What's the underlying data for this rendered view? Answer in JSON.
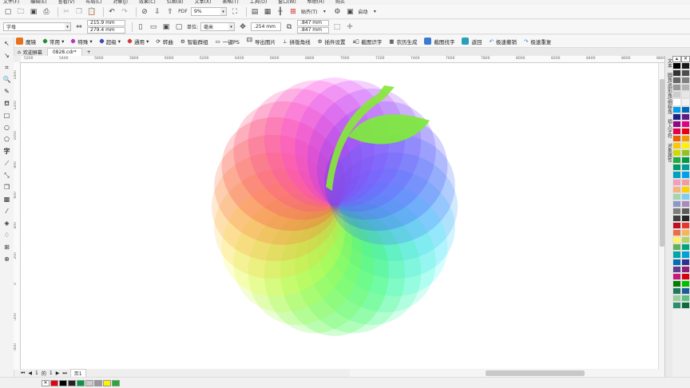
{
  "menubar": {
    "items": [
      "文件(F)",
      "编辑(E)",
      "查看(V)",
      "布局(L)",
      "对象(J)",
      "效果(C)",
      "位图(B)",
      "文本(X)",
      "表格(T)",
      "工具(O)",
      "窗口(W)",
      "帮助(H)",
      "购买"
    ]
  },
  "toolbar1": {
    "zoom_value": "9%",
    "snap_label": "贴齐(T)",
    "launch_label": "启动"
  },
  "toolbar2": {
    "preset_value": "字母",
    "width_value": "215.9 mm",
    "height_value": "279.4 mm",
    "units_label": "单位:",
    "units_value": "毫米",
    "nudge_value": ".254 mm",
    "dup_x_value": ".847 mm",
    "dup_y_value": ".847 mm"
  },
  "plugins": [
    {
      "label": "魔镜",
      "color": "#e8701a"
    },
    {
      "label": "常用",
      "color": "#2a8c3a"
    },
    {
      "label": "特殊",
      "color": "#b83ab8"
    },
    {
      "label": "超级",
      "color": "#3a4ab8"
    },
    {
      "label": "通用",
      "color": "#d43a3a"
    },
    {
      "label": "转曲",
      "color": "#555555"
    },
    {
      "label": "智能群组",
      "color": "#555555"
    },
    {
      "label": "一键PS",
      "color": "#555555"
    },
    {
      "label": "导出图片",
      "color": "#555555"
    },
    {
      "label": "拼版角线",
      "color": "#555555"
    },
    {
      "label": "插件设置",
      "color": "#555555"
    },
    {
      "label": "截图识字",
      "color": "#555555"
    },
    {
      "label": "农历生成",
      "color": "#555555"
    },
    {
      "label": "截图找字",
      "color": "#3a7ad4"
    },
    {
      "label": "返回",
      "color": "#2aa0b8"
    },
    {
      "label": "极速撤销",
      "color": "#3a7ad4"
    },
    {
      "label": "极速重复",
      "color": "#3a7ad4"
    }
  ],
  "tabs": [
    {
      "label": "欢迎屏幕"
    },
    {
      "label": "0828.cdr*"
    }
  ],
  "ruler_top_ticks": [
    "5200",
    "5400",
    "5600",
    "5800",
    "6000",
    "6200",
    "6400",
    "6600",
    "6800",
    "7000",
    "7200",
    "7400",
    "7600",
    "7800",
    "8000",
    "8200",
    "8400",
    "8600",
    "8800"
  ],
  "ruler_left_ticks": [
    "1400",
    "1200",
    "1000",
    "800",
    "600",
    "400",
    "200",
    "0",
    "-200",
    "-400",
    "-600"
  ],
  "pagebar": {
    "current": "1",
    "of": "的",
    "total": "1",
    "page_tab": "页1"
  },
  "docker_tabs": [
    "文本",
    "圆角/扇形角/倒棱角",
    "插入字符",
    "对象属性"
  ],
  "palette_colors": [
    "#000000",
    "#1a1a1a",
    "#333333",
    "#4d4d4d",
    "#666666",
    "#808080",
    "#999999",
    "#b3b3b3",
    "#cccccc",
    "#e6e6e6",
    "#ffffff",
    "#f2f2f2",
    "#00a0e9",
    "#0068b7",
    "#1d2088",
    "#601986",
    "#920783",
    "#e4007f",
    "#e5004f",
    "#e60012",
    "#eb6100",
    "#f39800",
    "#fcc800",
    "#fff100",
    "#cfdb00",
    "#8fc31f",
    "#22ac38",
    "#009944",
    "#009b6b",
    "#009e96",
    "#00a0c1",
    "#00a0e9",
    "#f19ec2",
    "#f29c9f",
    "#f6b37f",
    "#fdd000",
    "#a5d4ad",
    "#7ecef4",
    "#8c97cb",
    "#aa89bd",
    "#7d7d7d",
    "#5b5b5b",
    "#404040",
    "#262626",
    "#c30d23",
    "#e83828",
    "#ed6d46",
    "#f8b551",
    "#fff45c",
    "#b3d465",
    "#61b15a",
    "#00a381",
    "#00a7a7",
    "#00a0d8",
    "#036eb8",
    "#2e3192",
    "#603d8f",
    "#8e1f79",
    "#c9177f",
    "#d7000f",
    "#008000",
    "#00c000",
    "#1e7a5a",
    "#1a5d9a",
    "#9ad0a0",
    "#5ec184",
    "#2a8f6e",
    "#106b3b"
  ],
  "status_swatches": [
    "#e60012",
    "#000000",
    "#222222",
    "#009944",
    "#cccccc",
    "#999999",
    "#fff100",
    "#22ac38"
  ]
}
